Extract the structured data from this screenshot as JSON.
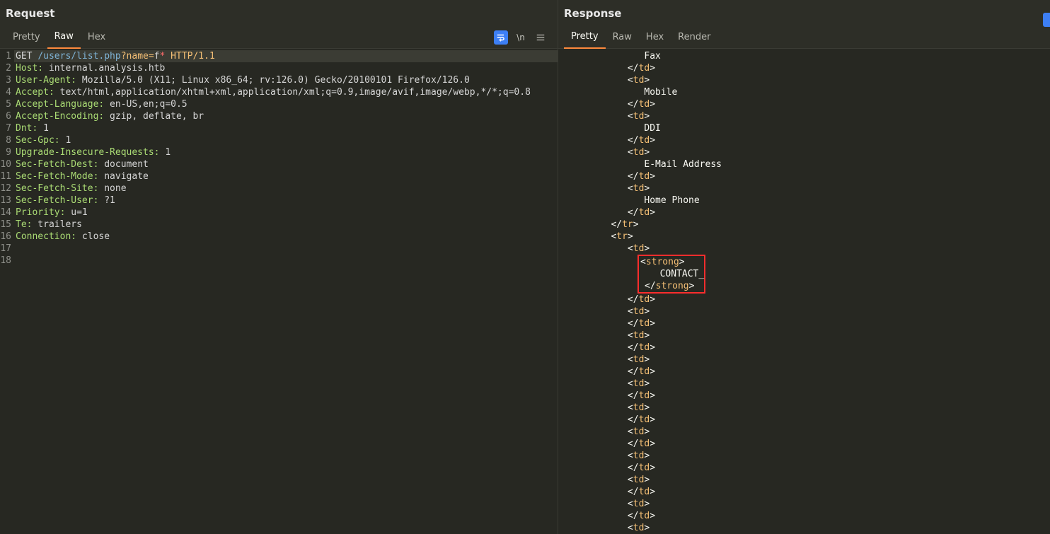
{
  "request": {
    "title": "Request",
    "tabs": {
      "pretty": "Pretty",
      "raw": "Raw",
      "hex": "Hex"
    },
    "activeTab": "Raw",
    "lines": [
      {
        "n": "1",
        "hl": true,
        "segs": [
          {
            "t": "method",
            "v": "GET "
          },
          {
            "t": "path",
            "v": "/users/list.php"
          },
          {
            "t": "query",
            "v": "?name="
          },
          {
            "t": "hval",
            "v": "f"
          },
          {
            "t": "star",
            "v": "*"
          },
          {
            "t": "proto",
            "v": " HTTP/1.1"
          }
        ]
      },
      {
        "n": "2",
        "segs": [
          {
            "t": "hname",
            "v": "Host:"
          },
          {
            "t": "hval",
            "v": " internal.analysis.htb"
          }
        ]
      },
      {
        "n": "3",
        "segs": [
          {
            "t": "hname",
            "v": "User-Agent:"
          },
          {
            "t": "hval",
            "v": " Mozilla/5.0 (X11; Linux x86_64; rv:126.0) Gecko/20100101 Firefox/126.0"
          }
        ]
      },
      {
        "n": "4",
        "segs": [
          {
            "t": "hname",
            "v": "Accept:"
          },
          {
            "t": "hval",
            "v": " text/html,application/xhtml+xml,application/xml;q=0.9,image/avif,image/webp,*/*;q=0.8"
          }
        ]
      },
      {
        "n": "5",
        "segs": [
          {
            "t": "hname",
            "v": "Accept-Language:"
          },
          {
            "t": "hval",
            "v": " en-US,en;q=0.5"
          }
        ]
      },
      {
        "n": "6",
        "segs": [
          {
            "t": "hname",
            "v": "Accept-Encoding:"
          },
          {
            "t": "hval",
            "v": " gzip, deflate, br"
          }
        ]
      },
      {
        "n": "7",
        "segs": [
          {
            "t": "hname",
            "v": "Dnt:"
          },
          {
            "t": "hval",
            "v": " 1"
          }
        ]
      },
      {
        "n": "8",
        "segs": [
          {
            "t": "hname",
            "v": "Sec-Gpc:"
          },
          {
            "t": "hval",
            "v": " 1"
          }
        ]
      },
      {
        "n": "9",
        "segs": [
          {
            "t": "hname",
            "v": "Upgrade-Insecure-Requests:"
          },
          {
            "t": "hval",
            "v": " 1"
          }
        ]
      },
      {
        "n": "10",
        "segs": [
          {
            "t": "hname",
            "v": "Sec-Fetch-Dest:"
          },
          {
            "t": "hval",
            "v": " document"
          }
        ]
      },
      {
        "n": "11",
        "segs": [
          {
            "t": "hname",
            "v": "Sec-Fetch-Mode:"
          },
          {
            "t": "hval",
            "v": " navigate"
          }
        ]
      },
      {
        "n": "12",
        "segs": [
          {
            "t": "hname",
            "v": "Sec-Fetch-Site:"
          },
          {
            "t": "hval",
            "v": " none"
          }
        ]
      },
      {
        "n": "13",
        "segs": [
          {
            "t": "hname",
            "v": "Sec-Fetch-User:"
          },
          {
            "t": "hval",
            "v": " ?1"
          }
        ]
      },
      {
        "n": "14",
        "segs": [
          {
            "t": "hname",
            "v": "Priority:"
          },
          {
            "t": "hval",
            "v": " u=1"
          }
        ]
      },
      {
        "n": "15",
        "segs": [
          {
            "t": "hname",
            "v": "Te:"
          },
          {
            "t": "hval",
            "v": " trailers"
          }
        ]
      },
      {
        "n": "16",
        "segs": [
          {
            "t": "hname",
            "v": "Connection:"
          },
          {
            "t": "hval",
            "v": " close"
          }
        ]
      },
      {
        "n": "17",
        "segs": []
      },
      {
        "n": "18",
        "segs": []
      }
    ]
  },
  "response": {
    "title": "Response",
    "tabs": {
      "pretty": "Pretty",
      "raw": "Raw",
      "hex": "Hex",
      "render": "Render"
    },
    "activeTab": "Pretty",
    "body": [
      {
        "indent": 5,
        "type": "text",
        "text": "Fax"
      },
      {
        "indent": 4,
        "type": "close",
        "tag": "td"
      },
      {
        "indent": 4,
        "type": "open",
        "tag": "td"
      },
      {
        "indent": 5,
        "type": "text",
        "text": "Mobile"
      },
      {
        "indent": 4,
        "type": "close",
        "tag": "td"
      },
      {
        "indent": 4,
        "type": "open",
        "tag": "td"
      },
      {
        "indent": 5,
        "type": "text",
        "text": "DDI"
      },
      {
        "indent": 4,
        "type": "close",
        "tag": "td"
      },
      {
        "indent": 4,
        "type": "open",
        "tag": "td"
      },
      {
        "indent": 5,
        "type": "text",
        "text": "E-Mail Address"
      },
      {
        "indent": 4,
        "type": "close",
        "tag": "td"
      },
      {
        "indent": 4,
        "type": "open",
        "tag": "td"
      },
      {
        "indent": 5,
        "type": "text",
        "text": "Home Phone"
      },
      {
        "indent": 4,
        "type": "close",
        "tag": "td"
      },
      {
        "indent": 3,
        "type": "close",
        "tag": "tr"
      },
      {
        "indent": 3,
        "type": "open",
        "tag": "tr"
      },
      {
        "indent": 4,
        "type": "open",
        "tag": "td"
      },
      {
        "indent": 5,
        "type": "open",
        "tag": "strong",
        "boxStart": true
      },
      {
        "indent": 6,
        "type": "text",
        "text": "CONTACT_"
      },
      {
        "indent": 5,
        "type": "close",
        "tag": "strong",
        "boxEnd": true
      },
      {
        "indent": 4,
        "type": "close",
        "tag": "td"
      },
      {
        "indent": 4,
        "type": "open",
        "tag": "td"
      },
      {
        "indent": 4,
        "type": "close",
        "tag": "td"
      },
      {
        "indent": 4,
        "type": "open",
        "tag": "td"
      },
      {
        "indent": 4,
        "type": "close",
        "tag": "td"
      },
      {
        "indent": 4,
        "type": "open",
        "tag": "td"
      },
      {
        "indent": 4,
        "type": "close",
        "tag": "td"
      },
      {
        "indent": 4,
        "type": "open",
        "tag": "td"
      },
      {
        "indent": 4,
        "type": "close",
        "tag": "td"
      },
      {
        "indent": 4,
        "type": "open",
        "tag": "td"
      },
      {
        "indent": 4,
        "type": "close",
        "tag": "td"
      },
      {
        "indent": 4,
        "type": "open",
        "tag": "td"
      },
      {
        "indent": 4,
        "type": "close",
        "tag": "td"
      },
      {
        "indent": 4,
        "type": "open",
        "tag": "td"
      },
      {
        "indent": 4,
        "type": "close",
        "tag": "td"
      },
      {
        "indent": 4,
        "type": "open",
        "tag": "td"
      },
      {
        "indent": 4,
        "type": "close",
        "tag": "td"
      },
      {
        "indent": 4,
        "type": "open",
        "tag": "td"
      },
      {
        "indent": 4,
        "type": "close",
        "tag": "td"
      },
      {
        "indent": 4,
        "type": "open",
        "tag": "td"
      }
    ]
  }
}
